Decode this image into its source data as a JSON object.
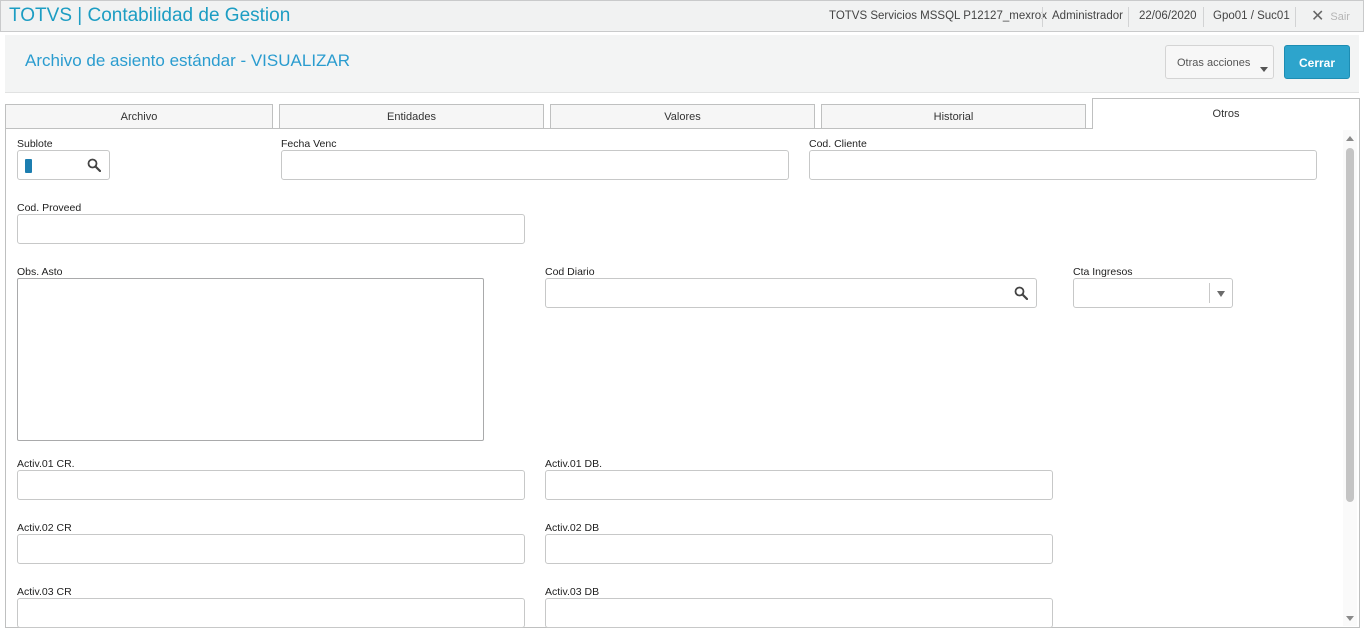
{
  "app": {
    "title": "TOTVS | Contabilidad de Gestion",
    "environment": "TOTVS Servicios MSSQL P12127_mexrox",
    "user": "Administrador",
    "date": "22/06/2020",
    "branch": "Gpo01 / Suc01",
    "logout_label": "Sair"
  },
  "header": {
    "page_title": "Archivo de asiento estándar - VISUALIZAR",
    "other_actions_label": "Otras acciones",
    "close_label": "Cerrar"
  },
  "tabs": [
    {
      "label": "Archivo"
    },
    {
      "label": "Entidades"
    },
    {
      "label": "Valores"
    },
    {
      "label": "Historial"
    },
    {
      "label": "Otros",
      "active": true
    }
  ],
  "form": {
    "sublote": {
      "label": "Sublote",
      "value": ""
    },
    "fecha_venc": {
      "label": "Fecha Venc",
      "value": ""
    },
    "cod_cliente": {
      "label": "Cod. Cliente",
      "value": ""
    },
    "cod_proveed": {
      "label": "Cod. Proveed",
      "value": ""
    },
    "obs_asto": {
      "label": "Obs. Asto",
      "value": ""
    },
    "cod_diario": {
      "label": "Cod Diario",
      "value": ""
    },
    "cta_ingresos": {
      "label": "Cta Ingresos",
      "value": ""
    },
    "activ01_cr": {
      "label": "Activ.01 CR.",
      "value": ""
    },
    "activ01_db": {
      "label": "Activ.01 DB.",
      "value": ""
    },
    "activ02_cr": {
      "label": "Activ.02 CR",
      "value": ""
    },
    "activ02_db": {
      "label": "Activ.02 DB",
      "value": ""
    },
    "activ03_cr": {
      "label": "Activ.03 CR",
      "value": ""
    },
    "activ03_db": {
      "label": "Activ.03 DB",
      "value": ""
    }
  },
  "icons": {
    "search": "search-icon",
    "close": "close-icon",
    "dropdown": "chevron-down-icon"
  },
  "colors": {
    "brand": "#1c9dc3",
    "primary_button": "#2da4cc",
    "title": "#2a9ccf"
  }
}
